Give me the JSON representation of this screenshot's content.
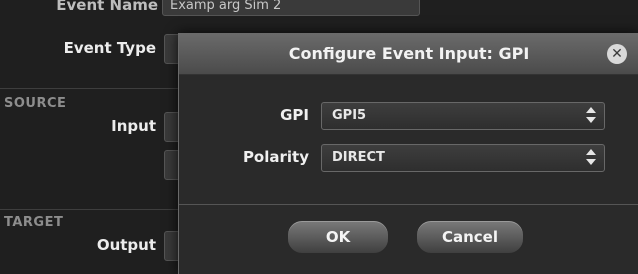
{
  "form": {
    "event_name_label": "Event Name",
    "event_name_value": "Examp arg Sim 2",
    "event_type_label": "Event Type",
    "source_section": "SOURCE",
    "input_label": "Input",
    "target_section": "TARGET",
    "output_label": "Output"
  },
  "dialog": {
    "title": "Configure Event Input: GPI",
    "close_glyph": "✕",
    "gpi_label": "GPI",
    "gpi_value": "GPI5",
    "polarity_label": "Polarity",
    "polarity_value": "DIRECT",
    "ok_label": "OK",
    "cancel_label": "Cancel"
  }
}
